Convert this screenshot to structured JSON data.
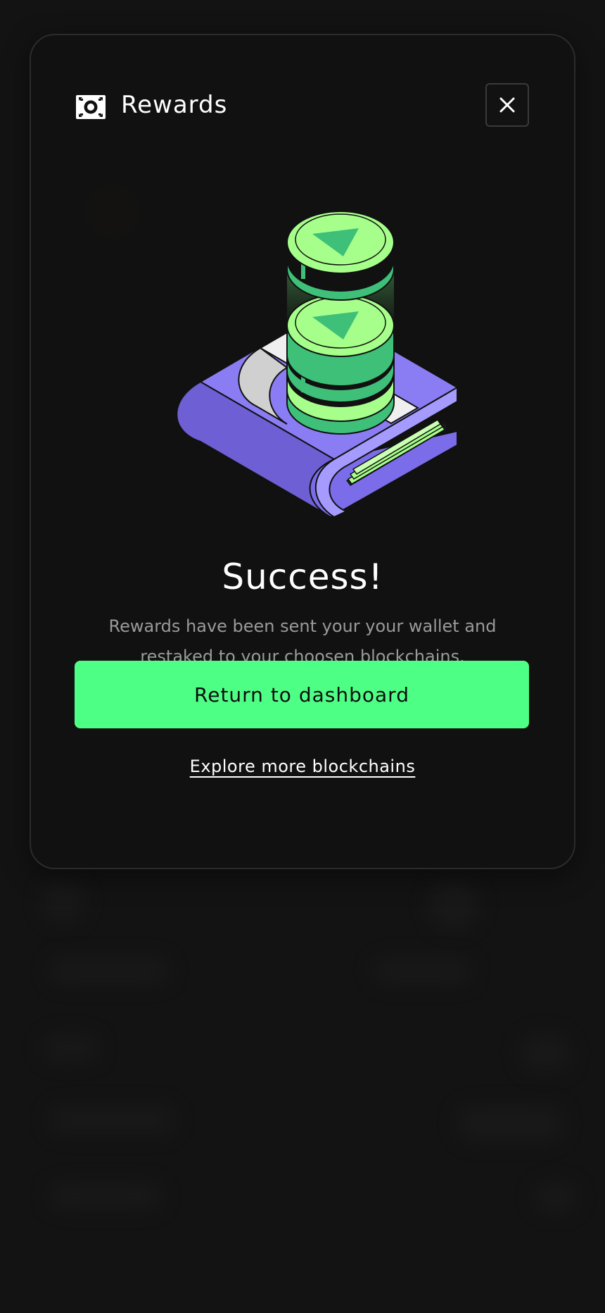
{
  "modal": {
    "title": "Rewards",
    "header_icon": "banknote-icon",
    "close_icon": "close-icon",
    "illustration": "wallet-coins-illustration",
    "success_title": "Success!",
    "success_description": "Rewards have been sent your your wallet and restaked to your choosen blockchains.",
    "primary_button_label": "Return to dashboard",
    "secondary_link_label": "Explore more blockchains"
  },
  "colors": {
    "background": "#131313",
    "modal_background": "#111111",
    "accent": "#4eff86",
    "wallet_purple": "#8273f0",
    "coin_green": "#a6ff8a",
    "text_muted": "#9a9a9a"
  }
}
